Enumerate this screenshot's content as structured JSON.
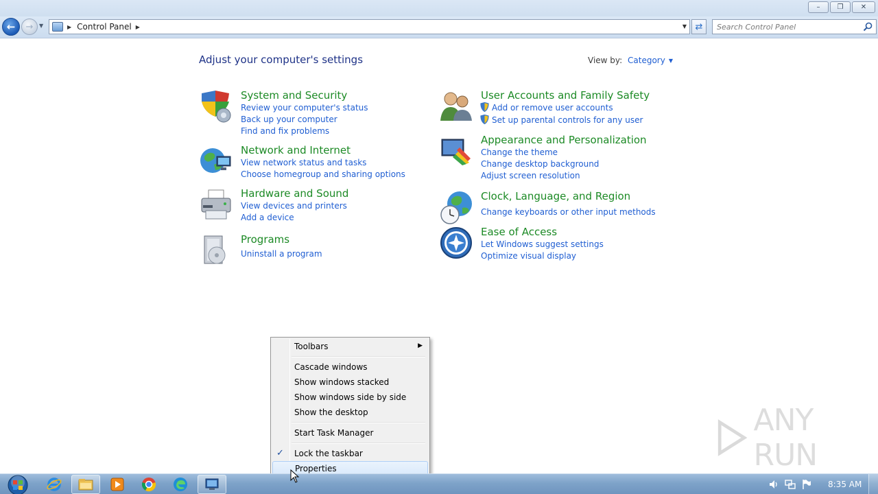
{
  "window": {
    "controls": {
      "minimize": "–",
      "restore": "❐",
      "close": "✕"
    }
  },
  "nav": {
    "back_icon": "back-arrow-icon",
    "forward_icon": "forward-arrow-icon",
    "address": {
      "crumb": "Control Panel"
    },
    "search": {
      "placeholder": "Search Control Panel"
    }
  },
  "main": {
    "title": "Adjust your computer's settings",
    "view_by": {
      "label": "View by:",
      "value": "Category"
    },
    "categories": [
      {
        "title": "System and Security",
        "icon": "shield-icon",
        "links": [
          "Review your computer's status",
          "Back up your computer",
          "Find and fix problems"
        ]
      },
      {
        "title": "Network and Internet",
        "icon": "globe-network-icon",
        "links": [
          "View network status and tasks",
          "Choose homegroup and sharing options"
        ]
      },
      {
        "title": "Hardware and Sound",
        "icon": "printer-icon",
        "links": [
          "View devices and printers",
          "Add a device"
        ]
      },
      {
        "title": "Programs",
        "icon": "programs-box-icon",
        "links": [
          "Uninstall a program"
        ]
      },
      {
        "title": "User Accounts and Family Safety",
        "icon": "users-icon",
        "links": [
          "Add or remove user accounts",
          "Set up parental controls for any user"
        ]
      },
      {
        "title": "Appearance and Personalization",
        "icon": "monitor-paint-icon",
        "links": [
          "Change the theme",
          "Change desktop background",
          "Adjust screen resolution"
        ]
      },
      {
        "title": "Clock, Language, and Region",
        "icon": "clock-globe-icon",
        "links": [
          "Change keyboards or other input methods"
        ]
      },
      {
        "title": "Ease of Access",
        "icon": "ease-of-access-icon",
        "links": [
          "Let Windows suggest settings",
          "Optimize visual display"
        ]
      }
    ]
  },
  "context_menu": {
    "items": [
      {
        "label": "Toolbars",
        "submenu": true
      },
      {
        "label": "Cascade windows"
      },
      {
        "label": "Show windows stacked"
      },
      {
        "label": "Show windows side by side"
      },
      {
        "label": "Show the desktop"
      },
      {
        "label": "Start Task Manager"
      },
      {
        "label": "Lock the taskbar",
        "checked": true
      },
      {
        "label": "Properties",
        "highlighted": true
      }
    ],
    "submenu_arrow": "▶",
    "check_mark": "✓"
  },
  "watermark": {
    "text": "ANY RUN"
  },
  "taskbar": {
    "pinned": [
      "internet-explorer-icon",
      "explorer-icon",
      "media-player-icon",
      "chrome-icon",
      "edge-icon",
      "control-panel-icon"
    ],
    "tray": [
      "volume-icon",
      "network-icon",
      "flag-icon"
    ],
    "clock": "8:35 AM"
  },
  "colors": {
    "link": "#1f5ed2",
    "category_title": "#1c8a25",
    "page_title": "#1e3287",
    "taskbar": "#7ea3c9"
  }
}
